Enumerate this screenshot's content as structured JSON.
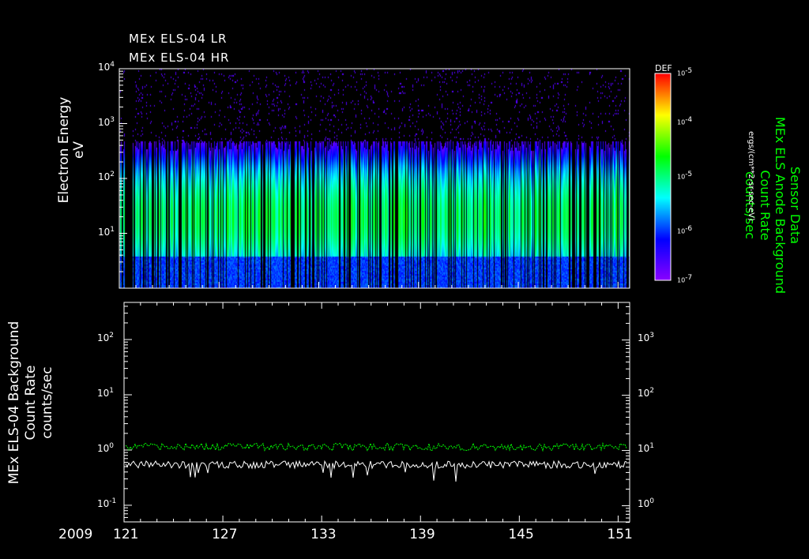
{
  "titles": [
    "MEx ELS-04 LR",
    "MEx ELS-04 HR"
  ],
  "year_label": "2009",
  "chart_data": [
    {
      "type": "heatmap",
      "title": "MEx ELS-04 LR / MEx ELS-04 HR",
      "ylabel": "Electron Energy",
      "yunits": "eV",
      "yscale": "log",
      "ylim": [
        1,
        10000
      ],
      "yticks": [
        {
          "base": "10",
          "exp": "1",
          "v": 10
        },
        {
          "base": "10",
          "exp": "2",
          "v": 100
        },
        {
          "base": "10",
          "exp": "3",
          "v": 1000
        },
        {
          "base": "10",
          "exp": "4",
          "v": 10000
        }
      ],
      "xlim": [
        121,
        151.7
      ],
      "xticks": [
        "121",
        "127",
        "133",
        "139",
        "145",
        "151"
      ],
      "xtick_values": [
        121,
        127,
        133,
        139,
        145,
        151
      ],
      "colorbar": {
        "label": "DEF",
        "units": "ergs/(cm**2-sr-sec-eV)",
        "scale": "log",
        "range": [
          1e-07,
          1e-05
        ],
        "ticks": [
          {
            "base": "10",
            "exp": "-5"
          },
          {
            "base": "10",
            "exp": "-4"
          },
          {
            "base": "10",
            "exp": "-5"
          },
          {
            "base": "10",
            "exp": "-6"
          },
          {
            "base": "10",
            "exp": "-7"
          }
        ]
      },
      "description_peak_energy_eV": 20,
      "data_gap_days": [
        121.3,
        121.8
      ]
    },
    {
      "type": "line",
      "ylabel_left": [
        "MEx ELS-04 Background",
        "Count Rate",
        "counts/sec"
      ],
      "ylabel_right": [
        "Sensor Data",
        "MEx ELS Anode Background",
        "Count Rate",
        "counts/sec"
      ],
      "yscale": "log",
      "ylim_left": [
        0.05,
        470
      ],
      "yticks_left": [
        {
          "base": "10",
          "exp": "-1"
        },
        {
          "base": "10",
          "exp": "0"
        },
        {
          "base": "10",
          "exp": "1"
        },
        {
          "base": "10",
          "exp": "2"
        }
      ],
      "yticks_right": [
        {
          "base": "10",
          "exp": "0"
        },
        {
          "base": "10",
          "exp": "1"
        },
        {
          "base": "10",
          "exp": "2"
        },
        {
          "base": "10",
          "exp": "3"
        }
      ],
      "xlim": [
        121,
        151.7
      ],
      "series": [
        {
          "name": "ELS-04 Background (left axis)",
          "color": "#ffffff",
          "mean": 0.55,
          "range": [
            0.25,
            0.8
          ]
        },
        {
          "name": "ELS Anode Background (right axis)",
          "color": "#00ff00",
          "mean": 11.5,
          "range": [
            10.5,
            13
          ]
        }
      ]
    }
  ]
}
